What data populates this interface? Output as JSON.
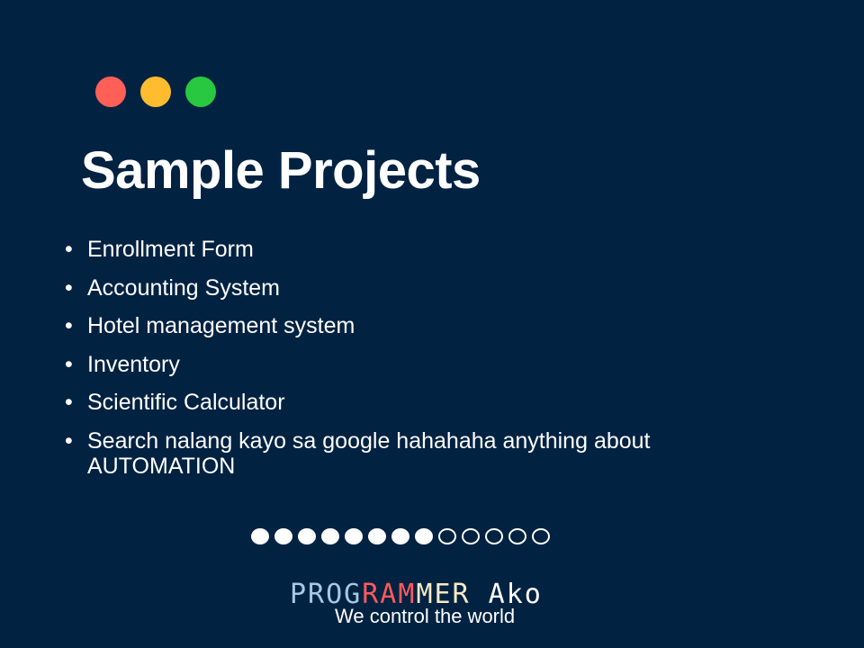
{
  "colors": {
    "background": "#022242",
    "window_close": "#fe5f57",
    "window_minimize": "#febc2e",
    "window_maximize": "#28c840",
    "brand_blue": "#a7c7e7",
    "brand_red": "#ff5a5a",
    "brand_cream": "#f7e9c4",
    "brand_white": "#ffffff"
  },
  "window_controls": [
    {
      "icon": "close-dot-icon",
      "color": "#fe5f57"
    },
    {
      "icon": "minimize-dot-icon",
      "color": "#febc2e"
    },
    {
      "icon": "maximize-dot-icon",
      "color": "#28c840"
    }
  ],
  "title": "Sample Projects",
  "bullet_symbol": "•",
  "projects": [
    "Enrollment Form",
    "Accounting System",
    "Hotel management system",
    "Inventory",
    "Scientific Calculator",
    "Search nalang kayo sa google hahahaha anything about AUTOMATION"
  ],
  "pager": {
    "total": 13,
    "filled": 8
  },
  "brand": {
    "part1": "PROG",
    "part2": "RAM",
    "part3": "MER",
    "part4": " Ako",
    "tagline": "We control the world"
  }
}
